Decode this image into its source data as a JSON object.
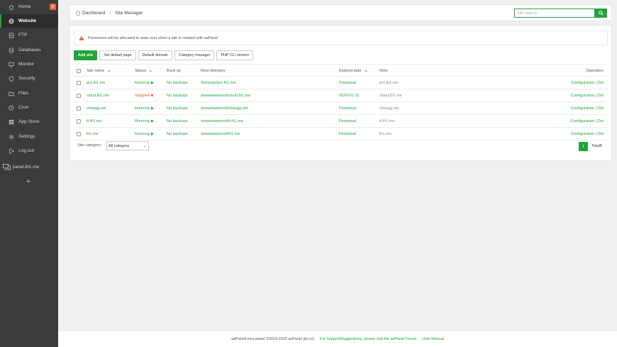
{
  "sidebar": {
    "items": [
      {
        "label": "Home",
        "icon": "home-icon",
        "badge": "0",
        "active": false
      },
      {
        "label": "Website",
        "icon": "globe-icon",
        "active": true
      },
      {
        "label": "FTP",
        "icon": "ftp-icon",
        "active": false
      },
      {
        "label": "Databases",
        "icon": "database-icon",
        "active": false
      },
      {
        "label": "Monitor",
        "icon": "monitor-icon",
        "active": false
      },
      {
        "label": "Security",
        "icon": "shield-icon",
        "active": false
      },
      {
        "label": "Files",
        "icon": "folder-icon",
        "active": false
      },
      {
        "label": "Cron",
        "icon": "clock-icon",
        "active": false
      },
      {
        "label": "App Store",
        "icon": "store-icon",
        "active": false
      },
      {
        "label": "Settings",
        "icon": "gear-icon",
        "active": false
      },
      {
        "label": "Log out",
        "icon": "logout-icon",
        "active": false
      }
    ],
    "panel_host": "panel.lh1.me",
    "add_label": "+"
  },
  "breadcrumb": {
    "home": "Dashboard",
    "separator": "/",
    "current": "Site Manager"
  },
  "search": {
    "placeholder": "Site search"
  },
  "warning": {
    "text": "Permission will be allocated to www user when a site is created with aaPanel"
  },
  "toolbar": {
    "add_site": "Add site",
    "default_page": "Set default page",
    "default_domain": "Default domain",
    "category_manager": "Category manager",
    "php_cli": "PHP CLI version"
  },
  "table": {
    "headers": {
      "name": "Site name",
      "status": "Status",
      "backup": "Back up",
      "root": "Root directory",
      "expire": "Expired date",
      "note": "Note",
      "operation": "Operation"
    },
    "rows": [
      {
        "name": "pro.lh1.me",
        "status": "Running",
        "status_icon": "▶",
        "running": true,
        "backup": "No backups",
        "root": "/home/pi/pro.lh1.me",
        "expire": "Perpetual",
        "expire_green": true,
        "note": "pro.lh1.me",
        "op": "Configuration | Del"
      },
      {
        "name": "cloud.lh1.me",
        "status": "Stopped",
        "status_icon": "■",
        "running": false,
        "backup": "No backups",
        "root": "/www/wwwroot/cloud.lh1.me",
        "expire": "2020-01-31",
        "expire_green": true,
        "note": "cloud.lh1.me",
        "op": "Configuration | Del"
      },
      {
        "name": "changg.net",
        "status": "Running",
        "status_icon": "▶",
        "running": true,
        "backup": "No backups",
        "root": "/www/wwwroot/changg.net",
        "expire": "Perpetual",
        "expire_green": true,
        "note": "changg.net",
        "op": "Configuration | Del"
      },
      {
        "name": "tt.lh1.me",
        "status": "Running",
        "status_icon": "▶",
        "running": true,
        "backup": "No backups",
        "root": "/www/wwwroot/tt.lh1.me",
        "expire": "Perpetual",
        "expire_green": true,
        "note": "tt.lh1.me",
        "op": "Configuration | Del"
      },
      {
        "name": "lh1.me",
        "status": "Running",
        "status_icon": "▶",
        "running": true,
        "backup": "No backups",
        "root": "/www/wwwroot/lh1.me",
        "expire": "Perpetual",
        "expire_green": true,
        "note": "lh1.me",
        "op": "Configuration | Del"
      }
    ]
  },
  "category": {
    "label": "Site category:",
    "selected": "All category"
  },
  "pagination": {
    "current": "1",
    "total": "Total5"
  },
  "footer": {
    "copyright": "aaPanelLinux panel ©2014-2020 aaPanel (bt.cn)",
    "support": "For Support|Suggestions, please visit the aaPanel Forum",
    "manual": "User Manual"
  },
  "colors": {
    "accent": "#20a53a",
    "sidebar_bg": "#3a3b3d",
    "stopped": "#ef4b27",
    "badge": "#f0633b"
  }
}
